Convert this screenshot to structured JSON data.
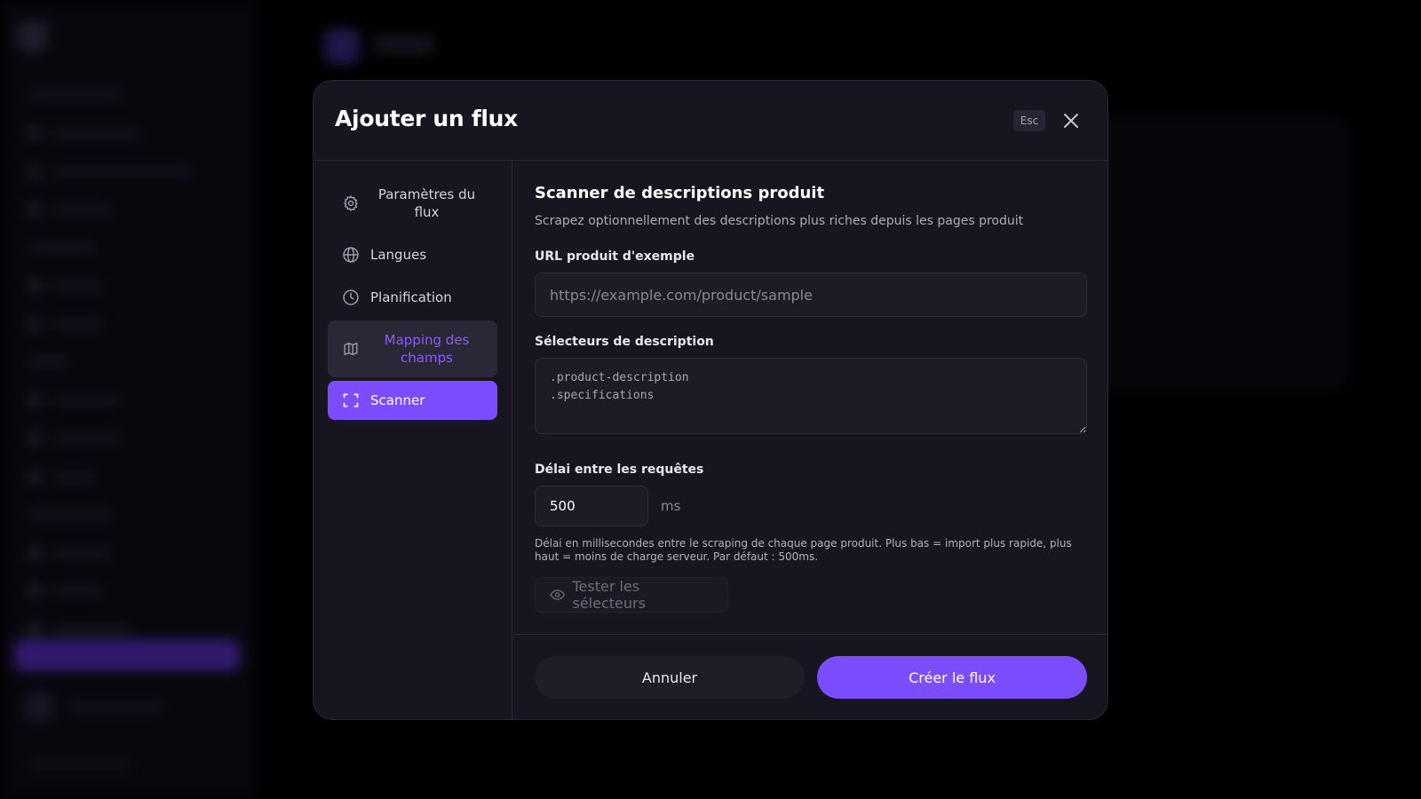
{
  "modal": {
    "title": "Ajouter un flux",
    "esc_label": "Esc"
  },
  "nav": {
    "items": [
      {
        "label": "Paramètres du flux",
        "icon": "gear-icon",
        "state": "default"
      },
      {
        "label": "Langues",
        "icon": "globe-icon",
        "state": "default"
      },
      {
        "label": "Planification",
        "icon": "clock-icon",
        "state": "default"
      },
      {
        "label": "Mapping des champs",
        "icon": "map-icon",
        "state": "hover"
      },
      {
        "label": "Scanner",
        "icon": "scan-icon",
        "state": "active"
      }
    ]
  },
  "scanner": {
    "title": "Scanner de descriptions produit",
    "subtitle": "Scrapez optionnellement des descriptions plus riches depuis les pages produit",
    "url_label": "URL produit d'exemple",
    "url_placeholder": "https://example.com/product/sample",
    "url_value": "",
    "selectors_label": "Sélecteurs de description",
    "selectors_value": ".product-description\n.specifications",
    "delay_label": "Délai entre les requêtes",
    "delay_value": "500",
    "delay_unit": "ms",
    "delay_help": "Délai en millisecondes entre le scraping de chaque page produit. Plus bas = import plus rapide, plus haut = moins de charge serveur. Par défaut : 500ms.",
    "test_label": "Tester les sélecteurs"
  },
  "footer": {
    "cancel_label": "Annuler",
    "create_label": "Créer le flux"
  },
  "colors": {
    "accent": "#7c4dff",
    "hover_text": "#8b5cf6",
    "modal_bg": "#17151f",
    "backdrop": "#000000"
  }
}
